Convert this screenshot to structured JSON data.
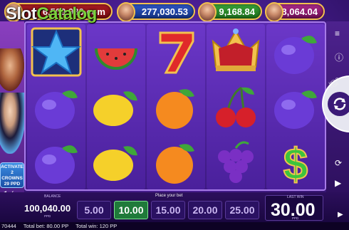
{
  "overlay_title": {
    "part1": "Slot",
    "part2": "Catalog"
  },
  "jackpots": [
    {
      "value": "6,509,986.com"
    },
    {
      "value": "277,030.53"
    },
    {
      "value": "9,168.84"
    },
    {
      "value": "8,064.04"
    }
  ],
  "left_panel": {
    "activate_lines": [
      "ACTIVATE",
      "2",
      "CROWNS",
      "29 PPD"
    ]
  },
  "reels": [
    [
      "blue-star",
      "plum",
      "plum"
    ],
    [
      "watermelon",
      "lemon",
      "lemon"
    ],
    [
      "seven",
      "orange",
      "orange"
    ],
    [
      "crown",
      "cherry",
      "grapes"
    ],
    [
      "plum",
      "plum",
      "dollar"
    ]
  ],
  "right_panel": {
    "hold_label": "HOLD FOR"
  },
  "balance": {
    "label": "BALANCE",
    "value": "100,040.00",
    "currency": "PPD"
  },
  "bet": {
    "label": "Place your bet",
    "options": [
      {
        "tiny": "BET",
        "value": "5.00",
        "selected": false
      },
      {
        "tiny": "BET",
        "value": "10.00",
        "selected": true
      },
      {
        "tiny": "BET",
        "value": "15.00",
        "selected": false
      },
      {
        "tiny": "BET",
        "value": "20.00",
        "selected": false
      },
      {
        "tiny": "BET",
        "value": "25.00",
        "selected": false
      }
    ]
  },
  "last_win": {
    "label": "LAST WIN",
    "value": "30.00",
    "currency": "PPD"
  },
  "footer": {
    "round": "70444",
    "total_bet": "Total bet: 80.00 PP",
    "total_win": "Total win: 120 PP"
  },
  "colors": {
    "background": "#4a1f93",
    "selected_bet": "#1f7a3a",
    "jackpot_border": "#f2c14e"
  }
}
